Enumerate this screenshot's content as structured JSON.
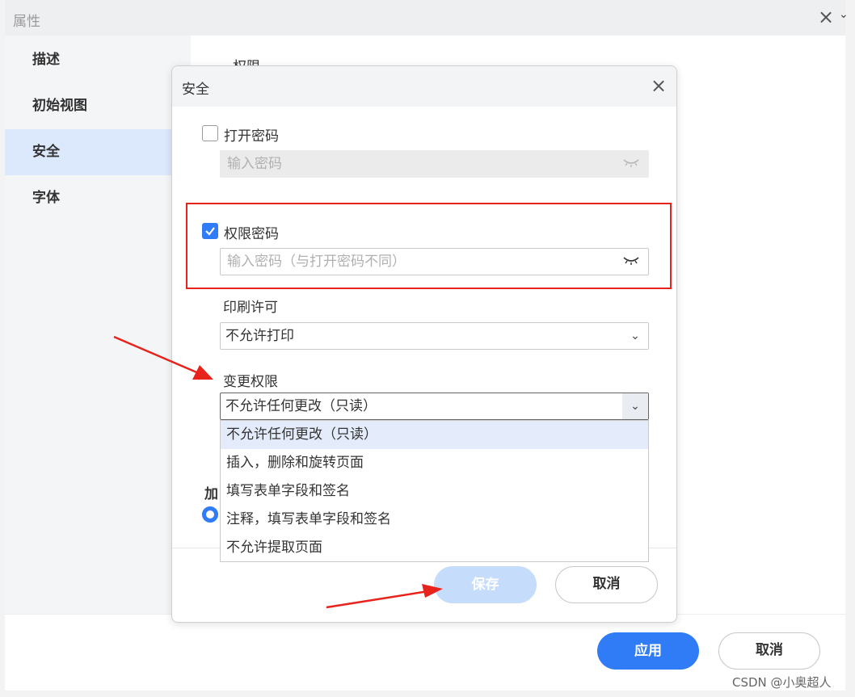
{
  "outer": {
    "title": "属性",
    "sidebar_items": [
      "描述",
      "初始视图",
      "安全",
      "字体"
    ],
    "active_item": "安全",
    "section_heading": "权限",
    "apply_label": "应用",
    "cancel_label": "取消"
  },
  "dialog": {
    "title": "安全",
    "open_password": {
      "label": "打开密码",
      "checked": false,
      "placeholder": "输入密码"
    },
    "permission_password": {
      "label": "权限密码",
      "checked": true,
      "placeholder": "输入密码（与打开密码不同）"
    },
    "print": {
      "label": "印刷许可",
      "value": "不允许打印"
    },
    "change": {
      "label": "变更权限",
      "value": "不允许任何更改（只读）",
      "options": [
        "不允许任何更改（只读）",
        "插入，删除和旋转页面",
        "填写表单字段和签名",
        "注释，填写表单字段和签名",
        "不允许提取页面"
      ]
    },
    "partial_label": "加",
    "save_label": "保存",
    "cancel_label": "取消"
  },
  "watermark": "CSDN @小奥超人",
  "colors": {
    "accent": "#2f7cf6",
    "highlight_box": "#e8231b",
    "annotation_arrow": "#e8231b"
  }
}
